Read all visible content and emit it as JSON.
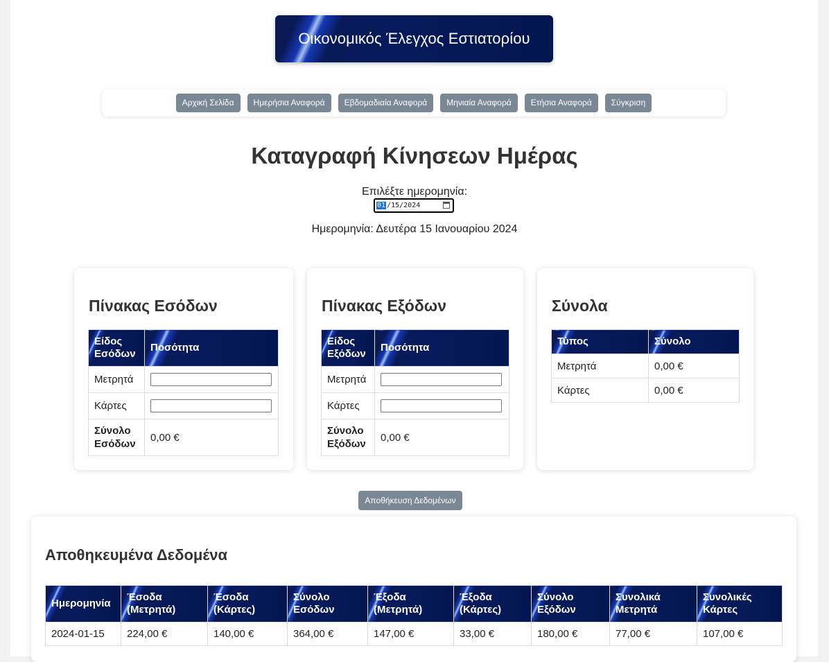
{
  "header": {
    "title": "Οικονομικός Έλεγχος Εστιατορίου"
  },
  "nav": {
    "items": [
      "Αρχική Σελίδα",
      "Ημερήσια Αναφορά",
      "Εβδομαδιαία Αναφορά",
      "Μηνιαία Αναφορά",
      "Ετήσια Αναφορά",
      "Σύγκριση"
    ]
  },
  "main": {
    "title": "Καταγραφή Κίνησεων Ημέρας",
    "date_label": "Επιλέξτε ημερομηνία:",
    "date_input": {
      "month": "01",
      "rest": "/15/2024"
    },
    "date_display": "Ημερομηνία: Δευτέρα 15 Ιανουαρίου 2024"
  },
  "income": {
    "title": "Πίνακας Εσόδων",
    "col1": "Είδος Εσόδων",
    "col2": "Ποσότητα",
    "rows": [
      "Μετρητά",
      "Κάρτες"
    ],
    "total_label": "Σύνολο Εσόδων",
    "total_value": "0,00 €"
  },
  "expenses": {
    "title": "Πίνακας Εξόδων",
    "col1": "Είδος Εξόδων",
    "col2": "Ποσότητα",
    "rows": [
      "Μετρητά",
      "Κάρτες"
    ],
    "total_label": "Σύνολο Εξόδων",
    "total_value": "0,00 €"
  },
  "totals": {
    "title": "Σύνολα",
    "col1": "Τύπος",
    "col2": "Σύνολο",
    "rows": [
      {
        "type": "Μετρητά",
        "value": "0,00 €"
      },
      {
        "type": "Κάρτες",
        "value": "0,00 €"
      }
    ]
  },
  "save_label": "Αποθήκευση Δεδομένων",
  "saved": {
    "title": "Αποθηκευμένα Δεδομένα",
    "headers": [
      "Ημερομηνία",
      "Έσοδα (Μετρητά)",
      "Έσοδα (Κάρτες)",
      "Σύνολο Εσόδων",
      "Έξοδα (Μετρητά)",
      "Έξοδα (Κάρτες)",
      "Σύνολο Εξόδων",
      "Συνολικά Μετρητά",
      "Συνολικές Κάρτες"
    ],
    "rows": [
      [
        "2024-01-15",
        "224,00 €",
        "140,00 €",
        "364,00 €",
        "147,00 €",
        "33,00 €",
        "180,00 €",
        "77,00 €",
        "107,00 €"
      ]
    ]
  },
  "colors": {
    "header_gradient_dark": "#041650",
    "button_gray": "#7a8896"
  }
}
